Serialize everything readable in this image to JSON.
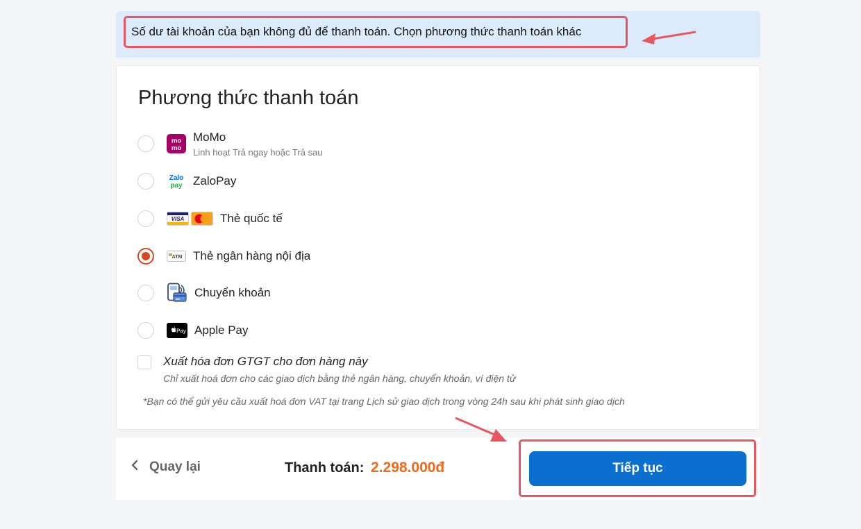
{
  "alert": {
    "message": "Số dư tài khoản của bạn không đủ để thanh toán. Chọn phương thức thanh toán khác"
  },
  "payment": {
    "title": "Phương thức thanh toán",
    "selected_index": 3,
    "options": [
      {
        "label": "MoMo",
        "sublabel": "Linh hoạt Trả ngay hoặc Trả sau",
        "icon": "momo-icon"
      },
      {
        "label": "ZaloPay",
        "icon": "zalopay-icon"
      },
      {
        "label": "Thẻ quốc tế",
        "icon": "visa-mastercard-icon"
      },
      {
        "label": "Thẻ ngân hàng nội địa",
        "icon": "atm-card-icon"
      },
      {
        "label": "Chuyển khoản",
        "icon": "bank-transfer-icon"
      },
      {
        "label": "Apple Pay",
        "icon": "apple-pay-icon"
      }
    ],
    "icon_texts": {
      "momo_top": "mo",
      "momo_bottom": "mo",
      "zalo_top": "Zalo",
      "zalo_bottom": "pay",
      "visa": "VISA",
      "atm": "ATM",
      "apple_pay": "Pay"
    },
    "invoice": {
      "label": "Xuất hóa đơn GTGT cho đơn hàng này",
      "sublabel": "Chỉ xuất hoá đơn cho các giao dịch bằng thẻ ngân hàng, chuyển khoản, ví điện tử",
      "checked": false
    },
    "note": "*Bạn có thể gửi yêu cầu xuất hoá đơn VAT tại trang Lịch sử giao dịch trong vòng 24h sau khi phát sinh giao dịch"
  },
  "footer": {
    "back_label": "Quay lại",
    "total_label": "Thanh toán:",
    "total_amount": "2.298.000đ",
    "continue_label": "Tiếp tục"
  },
  "colors": {
    "accent": "#0b6fd0",
    "selected": "#d9461f",
    "price": "#ef6a1a",
    "annotation": "#e8575f",
    "alert_bg": "#dcebfb"
  }
}
